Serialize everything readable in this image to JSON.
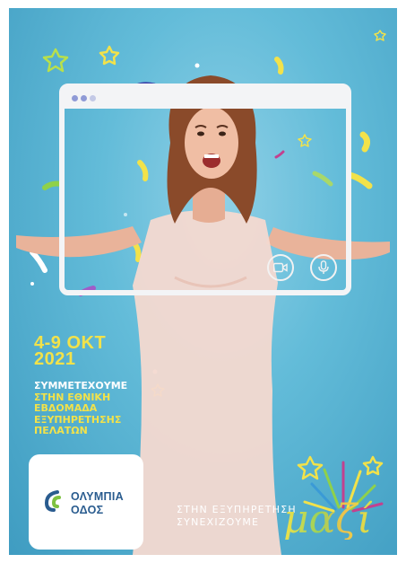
{
  "event": {
    "date_line1": "4-9 ΟΚΤ",
    "date_line2": "2021"
  },
  "message": {
    "lines": [
      "ΣΥΜΜΕΤΕΧΟΥΜΕ",
      "ΣΤΗΝ ΕΘΝΙΚΗ",
      "ΕΒΔΟΜΑΔΑ",
      "ΕΞΥΠΗΡΕΤΗΣΗΣ",
      "ΠΕΛΑΤΩΝ"
    ]
  },
  "logo": {
    "line1": "ΟΛΥΜΠΙΑ",
    "line2": "ΟΔΟΣ"
  },
  "tagline": {
    "line1": "ΣΤΗΝ ΕΞΥΠΗΡΕΤΗΣΗ",
    "line2": "ΣΥΝΕΧΙΖΟΥΜΕ",
    "highlight": "μαζί"
  },
  "icons": {
    "camera": "video-camera-icon",
    "mic": "microphone-icon"
  },
  "colors": {
    "background": "#63bcd9",
    "accent_yellow": "#f2e24a",
    "logo_blue": "#2a5c8f",
    "confetti_purple": "#3a3ea8",
    "confetti_pink": "#c2418f",
    "confetti_green": "#8fd14a"
  }
}
